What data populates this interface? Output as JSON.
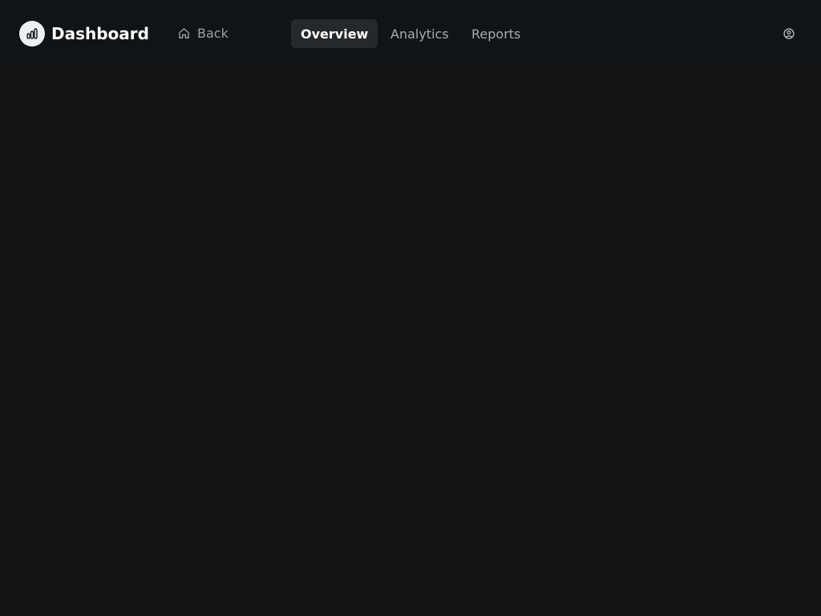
{
  "header": {
    "logo_icon": "bar-chart-icon",
    "app_title": "Dashboard",
    "back_label": "Back",
    "back_icon": "home-icon",
    "profile_icon": "user-circle-icon"
  },
  "nav": {
    "tabs": [
      {
        "label": "Overview",
        "active": true
      },
      {
        "label": "Analytics",
        "active": false
      },
      {
        "label": "Reports",
        "active": false
      }
    ]
  },
  "colors": {
    "background": "#141414",
    "topbar": "#111416",
    "active_tab_bg": "#26292b",
    "text_primary": "#ffffff",
    "text_muted": "#9aa0a6"
  }
}
